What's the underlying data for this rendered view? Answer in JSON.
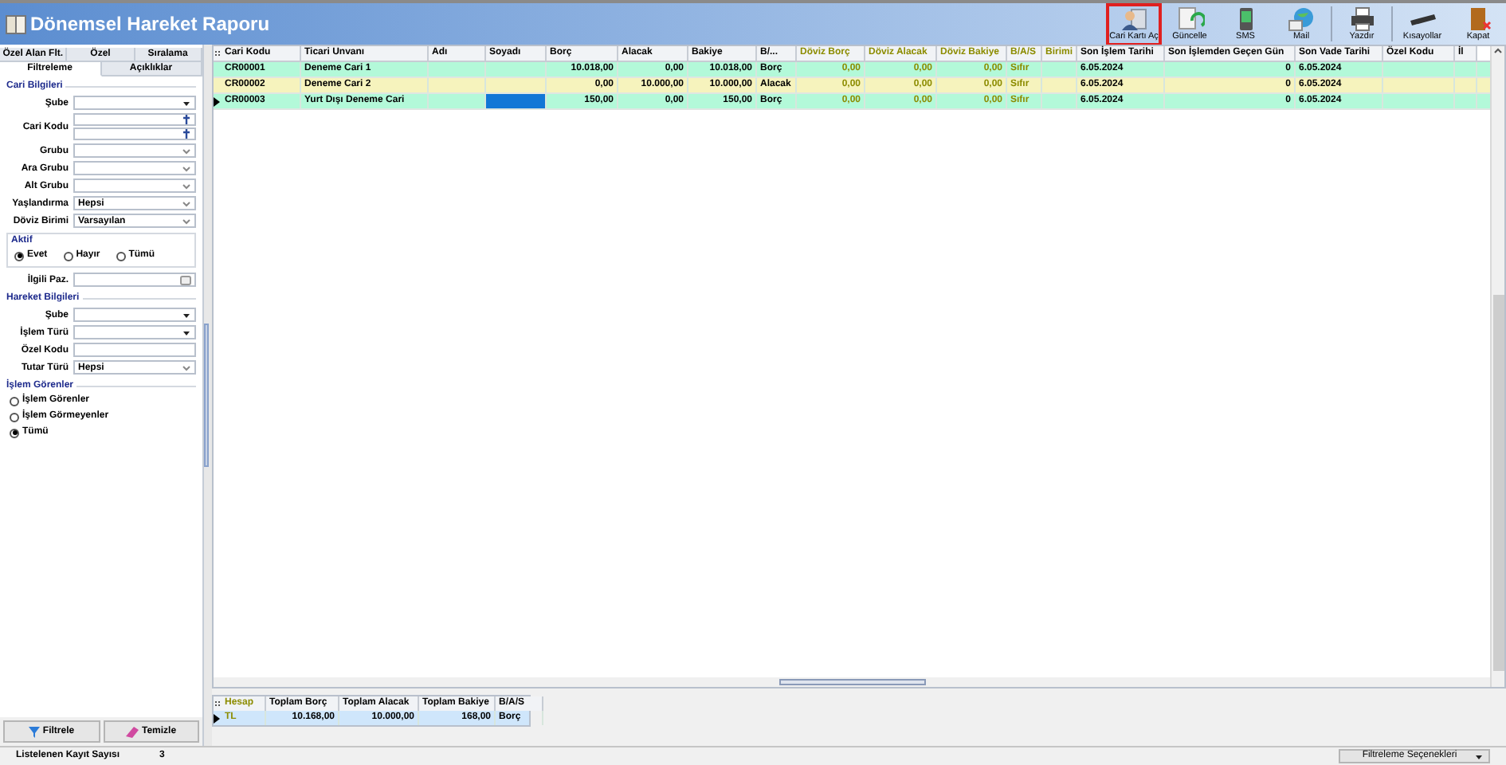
{
  "window": {
    "title": "Dönemsel Hareket Raporu"
  },
  "toolbar": [
    {
      "kind": "card",
      "label": "Cari Kartı Aç",
      "selected": true
    },
    {
      "kind": "refresh",
      "label": "Güncelle",
      "selected": false
    },
    {
      "kind": "sms",
      "label": "SMS",
      "selected": false
    },
    {
      "kind": "mail",
      "label": "Mail",
      "selected": false
    },
    {
      "kind": "print",
      "label": "Yazdır",
      "selected": false
    },
    {
      "kind": "keys",
      "label": "Kısayollar",
      "selected": false
    },
    {
      "kind": "exit",
      "label": "Kapat",
      "selected": false
    }
  ],
  "left_tabs": [
    [
      {
        "label": "Özel Alan Flt.",
        "selected": false
      },
      {
        "label": "Özel",
        "selected": false
      },
      {
        "label": "Sıralama",
        "selected": false
      }
    ],
    [
      {
        "label": "Filtreleme",
        "selected": true
      },
      {
        "label": "Açıklıklar",
        "selected": false
      }
    ]
  ],
  "filter_groups": [
    {
      "title": "Cari Bilgileri",
      "fields": [
        {
          "kind": "combo",
          "label": "Şube"
        },
        {
          "kind": "lookup2",
          "label": "Cari Kodu"
        },
        {
          "kind": "dropdown",
          "label": "Grubu"
        },
        {
          "kind": "dropdown",
          "label": "Ara Grubu"
        },
        {
          "kind": "dropdown",
          "label": "Alt Grubu"
        },
        {
          "kind": "dropdown",
          "label": "Yaşlandırma",
          "value": "Hepsi"
        },
        {
          "kind": "dropdown",
          "label": "Döviz Birimi",
          "value": "Varsayılan"
        },
        {
          "kind": "radios",
          "label": "Aktif",
          "options": [
            {
              "label": "Evet",
              "selected": true
            },
            {
              "label": "Hayır",
              "selected": false
            },
            {
              "label": "Tümü",
              "selected": false
            }
          ]
        },
        {
          "kind": "ellipsis",
          "label": "İlgili Paz."
        }
      ]
    },
    {
      "title": "Hareket Bilgileri",
      "fields": [
        {
          "kind": "combo",
          "label": "Şube"
        },
        {
          "kind": "combo",
          "label": "İşlem Türü"
        },
        {
          "kind": "text",
          "label": "Özel Kodu"
        },
        {
          "kind": "dropdown",
          "label": "Tutar Türü",
          "value": "Hepsi"
        }
      ]
    },
    {
      "title": "İşlem Görenler",
      "fields": [
        {
          "kind": "radiolist",
          "options": [
            {
              "label": "İşlem Görenler",
              "selected": false
            },
            {
              "label": "İşlem Görmeyenler",
              "selected": false
            },
            {
              "label": "Tümü",
              "selected": true
            }
          ]
        }
      ]
    }
  ],
  "filter_buttons": [
    {
      "kind": "filter",
      "label": "Filtrele"
    },
    {
      "kind": "clear",
      "label": "Temizle"
    }
  ],
  "table": {
    "columns": [
      {
        "label": "Cari Kodu",
        "kind": "text",
        "focused": false
      },
      {
        "label": "Ticari Unvanı",
        "kind": "text",
        "focused": false
      },
      {
        "label": "Adı",
        "kind": "text",
        "focused": false
      },
      {
        "label": "Soyadı",
        "kind": "text",
        "focused": true
      },
      {
        "label": "Borç",
        "kind": "number",
        "focused": false
      },
      {
        "label": "Alacak",
        "kind": "number",
        "focused": false
      },
      {
        "label": "Bakiye",
        "kind": "number",
        "focused": false
      },
      {
        "label": "B/...",
        "kind": "text",
        "focused": false
      },
      {
        "label": "Döviz Borç",
        "kind": "currency",
        "focused": false
      },
      {
        "label": "Döviz Alacak",
        "kind": "currency",
        "focused": false
      },
      {
        "label": "Döviz Bakiye",
        "kind": "currency",
        "focused": false
      },
      {
        "label": "B/A/S",
        "kind": "currency_text",
        "focused": false
      },
      {
        "label": "Birimi",
        "kind": "currency_text",
        "focused": false
      },
      {
        "label": "Son İşlem Tarihi",
        "kind": "text",
        "focused": false
      },
      {
        "label": "Son İşlemden Geçen Gün",
        "kind": "number",
        "focused": false
      },
      {
        "label": "Son Vade Tarihi",
        "kind": "text",
        "focused": false
      },
      {
        "label": "Özel Kodu",
        "kind": "text",
        "focused": false
      },
      {
        "label": "İl",
        "kind": "text",
        "focused": false
      }
    ],
    "rows": [
      {
        "color": "#b3f9d9",
        "current": false,
        "cells": [
          "CR00001",
          "Deneme Cari 1",
          null,
          null,
          "10.018,00",
          "0,00",
          "10.018,00",
          "Borç",
          "0,00",
          "0,00",
          "0,00",
          "Sıfır",
          null,
          "6.05.2024",
          "0",
          "6.05.2024",
          null,
          null
        ]
      },
      {
        "color": "#f6f3bd",
        "current": false,
        "cells": [
          "CR00002",
          "Deneme Cari 2",
          null,
          null,
          "0,00",
          "10.000,00",
          "10.000,00",
          "Alacak",
          "0,00",
          "0,00",
          "0,00",
          "Sıfır",
          null,
          "6.05.2024",
          "0",
          "6.05.2024",
          null,
          null
        ]
      },
      {
        "color": "#b3f9d9",
        "current": true,
        "cells": [
          "CR00003",
          "Yurt Dışı Deneme Cari",
          null,
          null,
          "150,00",
          "0,00",
          "150,00",
          "Borç",
          "0,00",
          "0,00",
          "0,00",
          "Sıfır",
          null,
          "6.05.2024",
          "0",
          "6.05.2024",
          null,
          null
        ]
      }
    ]
  },
  "summary": {
    "columns": [
      {
        "label": "Hesap",
        "kind": "currency_text"
      },
      {
        "label": "Toplam Borç",
        "kind": "number"
      },
      {
        "label": "Toplam Alacak",
        "kind": "number"
      },
      {
        "label": "Toplam Bakiye",
        "kind": "number"
      },
      {
        "label": "B/A/S",
        "kind": "text"
      }
    ],
    "rows": [
      {
        "current": true,
        "cells": [
          "TL",
          "10.168,00",
          "10.000,00",
          "168,00",
          "Borç"
        ]
      }
    ]
  },
  "status_bar": {
    "label": "Listelenen Kayıt Sayısı",
    "count": "3",
    "options": "Filtreleme Seçenekleri"
  }
}
